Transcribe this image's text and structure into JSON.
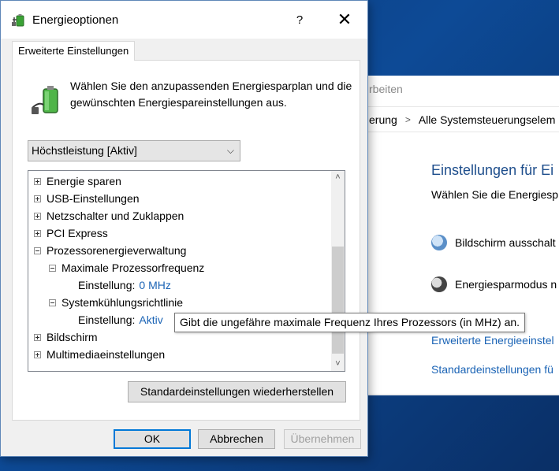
{
  "background_window": {
    "menu_label": "rbeiten",
    "breadcrumb_left": "erung",
    "breadcrumb_sep": ">",
    "breadcrumb_current": "Alle Systemsteuerungselem",
    "heading": "Einstellungen für Ei",
    "subheading": "Wählen Sie die Energiesp",
    "option_display": "Bildschirm ausschalt",
    "option_sleep": "Energiesparmodus n",
    "link_advanced": "Erweiterte Energieeinstel",
    "link_defaults": "Standardeinstellungen fü"
  },
  "dialog": {
    "title": "Energieoptionen",
    "help_label": "?",
    "close_label": "✕",
    "tab_label": "Erweiterte Einstellungen",
    "intro_text": "Wählen Sie den anzupassenden Energiesparplan und die gewünschten Energiespareinstellungen aus.",
    "plan_selected": "Höchstleistung [Aktiv]",
    "tree": [
      {
        "label": "Energie sparen",
        "expander": "plus"
      },
      {
        "label": "USB-Einstellungen",
        "expander": "plus"
      },
      {
        "label": "Netzschalter und Zuklappen",
        "expander": "plus"
      },
      {
        "label": "PCI Express",
        "expander": "plus"
      },
      {
        "label": "Prozessorenergieverwaltung",
        "expander": "minus"
      },
      {
        "label": "Maximale Prozessorfrequenz",
        "expander": "minus"
      },
      {
        "label": "Einstellung:",
        "value": "0 MHz"
      },
      {
        "label": "Systemkühlungsrichtlinie",
        "expander": "minus"
      },
      {
        "label": "Einstellung:",
        "value": "Aktiv"
      },
      {
        "label": "Bildschirm",
        "expander": "plus"
      },
      {
        "label": "Multimediaeinstellungen",
        "expander": "plus"
      }
    ],
    "tooltip": "Gibt die ungefähre maximale Frequenz Ihres Prozessors (in MHz) an.",
    "restore_button": "Standardeinstellungen wiederherstellen",
    "ok_button": "OK",
    "cancel_button": "Abbrechen",
    "apply_button": "Übernehmen"
  },
  "colors": {
    "accent": "#0078d7",
    "link": "#1a63b5",
    "heading": "#1e4e8c"
  }
}
